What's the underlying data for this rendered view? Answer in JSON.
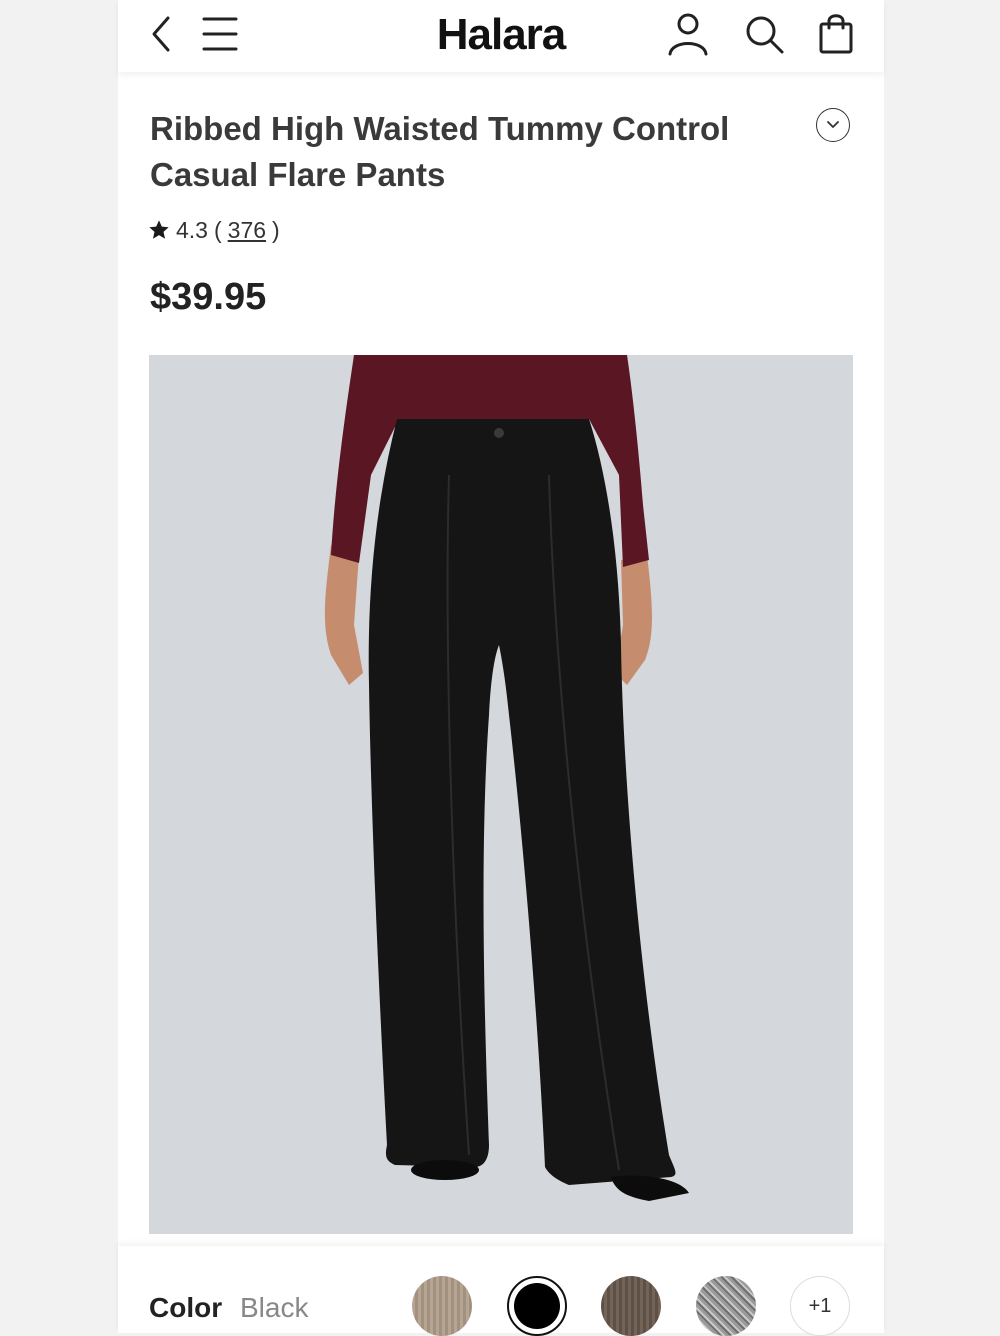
{
  "header": {
    "brand": "Halara",
    "icons": [
      "back-icon",
      "menu-icon",
      "account-icon",
      "search-icon",
      "shopping-bag-icon"
    ]
  },
  "product": {
    "title_line1": "Ribbed High Waisted Tummy Control",
    "title_line2": "Casual Flare Pants",
    "rating": "4.3",
    "review_open": "(",
    "review_count": "376",
    "review_close": ")",
    "price": "$39.95"
  },
  "color": {
    "label": "Color",
    "selected": "Black",
    "more": "+1",
    "swatches": [
      {
        "name": "beige-ribbed",
        "hex": "#b7a593"
      },
      {
        "name": "black",
        "hex": "#000000"
      },
      {
        "name": "brown-ribbed",
        "hex": "#5e5046"
      },
      {
        "name": "grey-tweed",
        "hex": "#9a9a9a"
      }
    ]
  },
  "colors": {
    "background": "#f2f2f2",
    "photo_bg": "#d4d7db",
    "top": "#5a1622",
    "pants": "#151515",
    "skin": "#c58d6d"
  }
}
